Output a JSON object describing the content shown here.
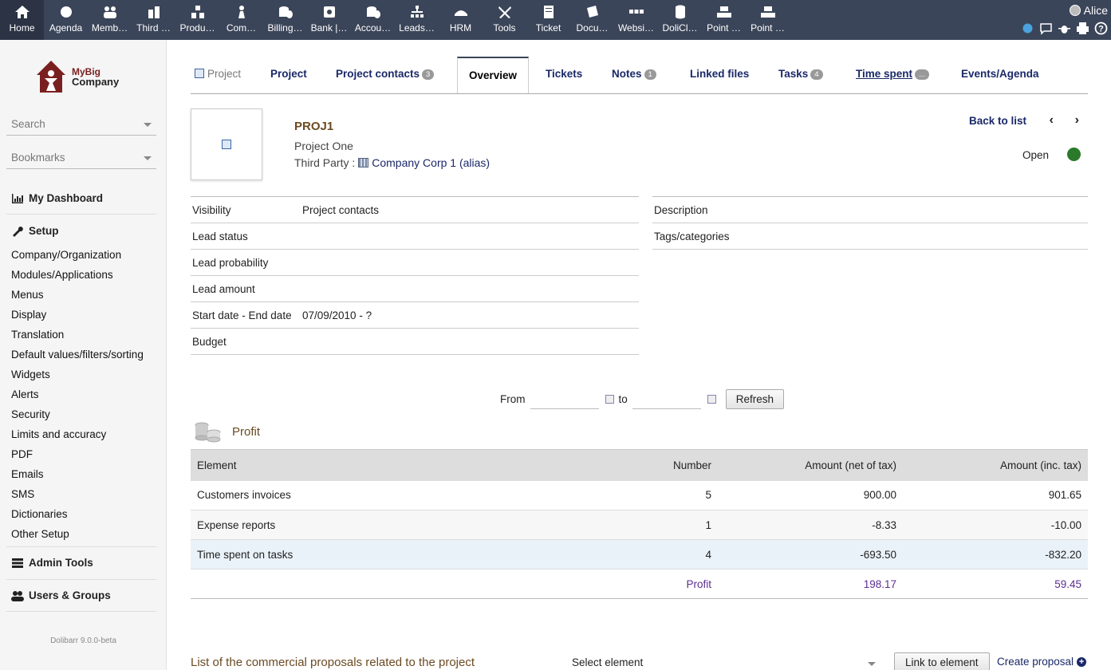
{
  "topbar": {
    "items": [
      {
        "label": "Home",
        "icon": "home-icon"
      },
      {
        "label": "Agenda",
        "icon": "agenda-icon"
      },
      {
        "label": "Memb…",
        "icon": "members-icon"
      },
      {
        "label": "Third …",
        "icon": "third-party-icon"
      },
      {
        "label": "Produ…",
        "icon": "products-icon"
      },
      {
        "label": "Com…",
        "icon": "commerce-icon"
      },
      {
        "label": "Billing…",
        "icon": "billing-icon"
      },
      {
        "label": "Bank |…",
        "icon": "bank-icon"
      },
      {
        "label": "Accou…",
        "icon": "accounting-icon"
      },
      {
        "label": "Leads…",
        "icon": "leads-icon"
      },
      {
        "label": "HRM",
        "icon": "hrm-icon"
      },
      {
        "label": "Tools",
        "icon": "tools-icon"
      },
      {
        "label": "Ticket",
        "icon": "ticket-icon"
      },
      {
        "label": "Docu…",
        "icon": "documents-icon"
      },
      {
        "label": "Websi…",
        "icon": "website-icon"
      },
      {
        "label": "DoliCl…",
        "icon": "database-icon"
      },
      {
        "label": "Point …",
        "icon": "pos-icon"
      },
      {
        "label": "Point …",
        "icon": "pos-icon"
      }
    ],
    "user": "Alice"
  },
  "sidebar": {
    "logo_line1": "MyBig",
    "logo_line2": "Company",
    "search_placeholder": "Search",
    "bookmarks_placeholder": "Bookmarks",
    "dashboard": "My Dashboard",
    "setup": "Setup",
    "setup_items": [
      "Company/Organization",
      "Modules/Applications",
      "Menus",
      "Display",
      "Translation",
      "Default values/filters/sorting",
      "Widgets",
      "Alerts",
      "Security",
      "Limits and accuracy",
      "PDF",
      "Emails",
      "SMS",
      "Dictionaries",
      "Other Setup"
    ],
    "admin_tools": "Admin Tools",
    "users_groups": "Users & Groups",
    "version": "Dolibarr 9.0.0-beta"
  },
  "tabs": [
    {
      "label": "Project",
      "badge": ""
    },
    {
      "label": "Project",
      "badge": ""
    },
    {
      "label": "Project contacts",
      "badge": "3"
    },
    {
      "label": "Overview",
      "badge": ""
    },
    {
      "label": "Tickets",
      "badge": ""
    },
    {
      "label": "Notes",
      "badge": "1"
    },
    {
      "label": "Linked files",
      "badge": ""
    },
    {
      "label": "Tasks",
      "badge": "4"
    },
    {
      "label": "Time spent",
      "badge": "..."
    },
    {
      "label": "Events/Agenda",
      "badge": ""
    }
  ],
  "project": {
    "ref": "PROJ1",
    "label": "Project One",
    "third_party_label": "Third Party :",
    "third_party_name": "Company Corp 1 (alias)",
    "back_to_list": "Back to list",
    "status": "Open"
  },
  "fields_left": [
    {
      "label": "Visibility",
      "value": "Project contacts"
    },
    {
      "label": "Lead status",
      "value": ""
    },
    {
      "label": "Lead probability",
      "value": ""
    },
    {
      "label": "Lead amount",
      "value": ""
    },
    {
      "label": "Start date - End date",
      "value": "07/09/2010 - ?"
    },
    {
      "label": "Budget",
      "value": ""
    }
  ],
  "fields_right": [
    {
      "label": "Description",
      "value": ""
    },
    {
      "label": "Tags/categories",
      "value": ""
    }
  ],
  "period": {
    "from_label": "From",
    "to_label": "to",
    "refresh": "Refresh"
  },
  "profit": {
    "title": "Profit",
    "headers": [
      "Element",
      "Number",
      "Amount (net of tax)",
      "Amount (inc. tax)"
    ],
    "rows": [
      {
        "element": "Customers invoices",
        "number": "5",
        "net": "900.00",
        "inc": "901.65"
      },
      {
        "element": "Expense reports",
        "number": "1",
        "net": "-8.33",
        "inc": "-10.00"
      },
      {
        "element": "Time spent on tasks",
        "number": "4",
        "net": "-693.50",
        "inc": "-832.20"
      }
    ],
    "total": {
      "label": "Profit",
      "net": "198.17",
      "inc": "59.45"
    }
  },
  "proposals": {
    "title": "List of the commercial proposals related to the project",
    "select_placeholder": "Select element",
    "link_button": "Link to element",
    "create_link": "Create proposal"
  },
  "colors": {
    "topbar": "#3b4559",
    "link": "#1a2868",
    "title": "#6b4a22",
    "status_open": "#2b7a2b",
    "total": "#5b2e91"
  }
}
